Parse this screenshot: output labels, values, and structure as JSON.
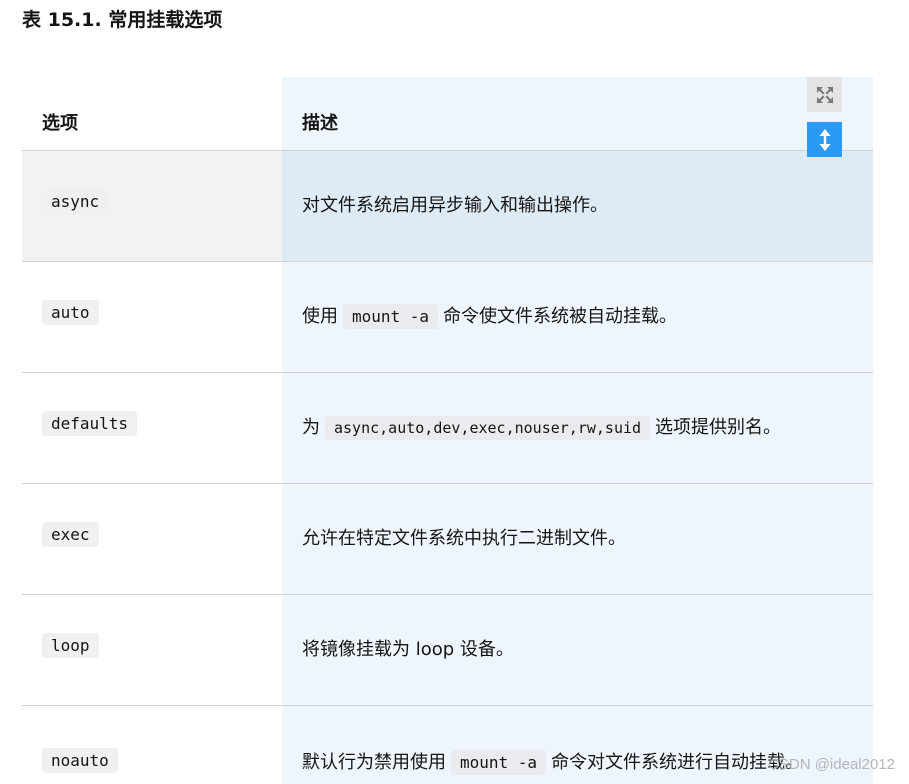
{
  "caption": "表 15.1. 常用挂载选项",
  "table": {
    "headers": {
      "option": "选项",
      "description": "描述"
    },
    "rows": [
      {
        "option": "async",
        "desc_before": "对文件系统启用异步输入和输出操作。",
        "desc_code": "",
        "desc_after": ""
      },
      {
        "option": "auto",
        "desc_before": "使用",
        "desc_code": "mount -a",
        "desc_after": "命令使文件系统被自动挂载。"
      },
      {
        "option": "defaults",
        "desc_before": "为",
        "desc_code": "async,auto,dev,exec,nouser,rw,suid",
        "desc_after": "选项提供别名。"
      },
      {
        "option": "exec",
        "desc_before": "允许在特定文件系统中执行二进制文件。",
        "desc_code": "",
        "desc_after": ""
      },
      {
        "option": "loop",
        "desc_before": "将镜像挂载为 loop 设备。",
        "desc_code": "",
        "desc_after": ""
      },
      {
        "option": "noauto",
        "desc_before": "默认行为禁用使用",
        "desc_code": "mount -a",
        "desc_after": "命令对文件系统进行自动挂载。"
      }
    ]
  },
  "controls": {
    "expand_icon": "expand-arrows-icon",
    "height_icon": "vertical-resize-icon"
  },
  "colors": {
    "description_column_bg": "#eef5fc",
    "highlight_row_bg": "#f2f2f2",
    "resize_button_bg": "#2b9af3"
  },
  "watermark": "CSDN @ideal2012"
}
